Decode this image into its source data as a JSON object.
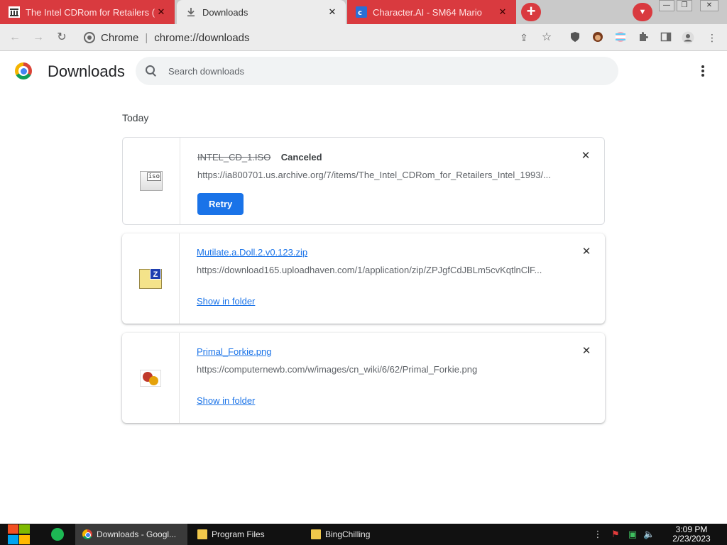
{
  "tabs": [
    {
      "title": "The Intel CDRom for Retailers (",
      "favicon": "archive-icon",
      "state": "inactive"
    },
    {
      "title": "Downloads",
      "favicon": "download-icon",
      "state": "active"
    },
    {
      "title": "Character.AI - SM64 Mario",
      "favicon": "character-ai-icon",
      "state": "inactive"
    }
  ],
  "omnibox": {
    "site_label": "Chrome",
    "url": "chrome://downloads"
  },
  "page": {
    "title": "Downloads",
    "search_placeholder": "Search downloads",
    "section": "Today"
  },
  "downloads": [
    {
      "file_name": "INTEL_CD_1.ISO",
      "status": "Canceled",
      "url": "https://ia800701.us.archive.org/7/items/The_Intel_CDRom_for_Retailers_Intel_1993/...",
      "action": "Retry",
      "icon": "iso-file-icon",
      "icon_text": "iso"
    },
    {
      "file_name": "Mutilate.a.Doll.2.v0.123.zip",
      "url": "https://download165.uploadhaven.com/1/application/zip/ZPJgfCdJBLm5cvKqtlnClF...",
      "action": "Show in folder",
      "icon": "zip-file-icon",
      "icon_text": "Z"
    },
    {
      "file_name": "Primal_Forkie.png",
      "url": "https://computernewb.com/w/images/cn_wiki/6/62/Primal_Forkie.png",
      "action": "Show in folder",
      "icon": "image-file-icon"
    }
  ],
  "taskbar": {
    "tasks": [
      {
        "label": "Downloads - Googl...",
        "icon": "chrome-icon",
        "active": true
      },
      {
        "label": "Program Files",
        "icon": "folder-icon",
        "active": false
      },
      {
        "label": "BingChilling",
        "icon": "folder-icon",
        "active": false
      }
    ],
    "clock_time": "3:09 PM",
    "clock_date": "2/23/2023"
  },
  "colors": {
    "tab_red": "#d93a3f",
    "accent_blue": "#1a73e8",
    "taskbar": "#111111"
  }
}
